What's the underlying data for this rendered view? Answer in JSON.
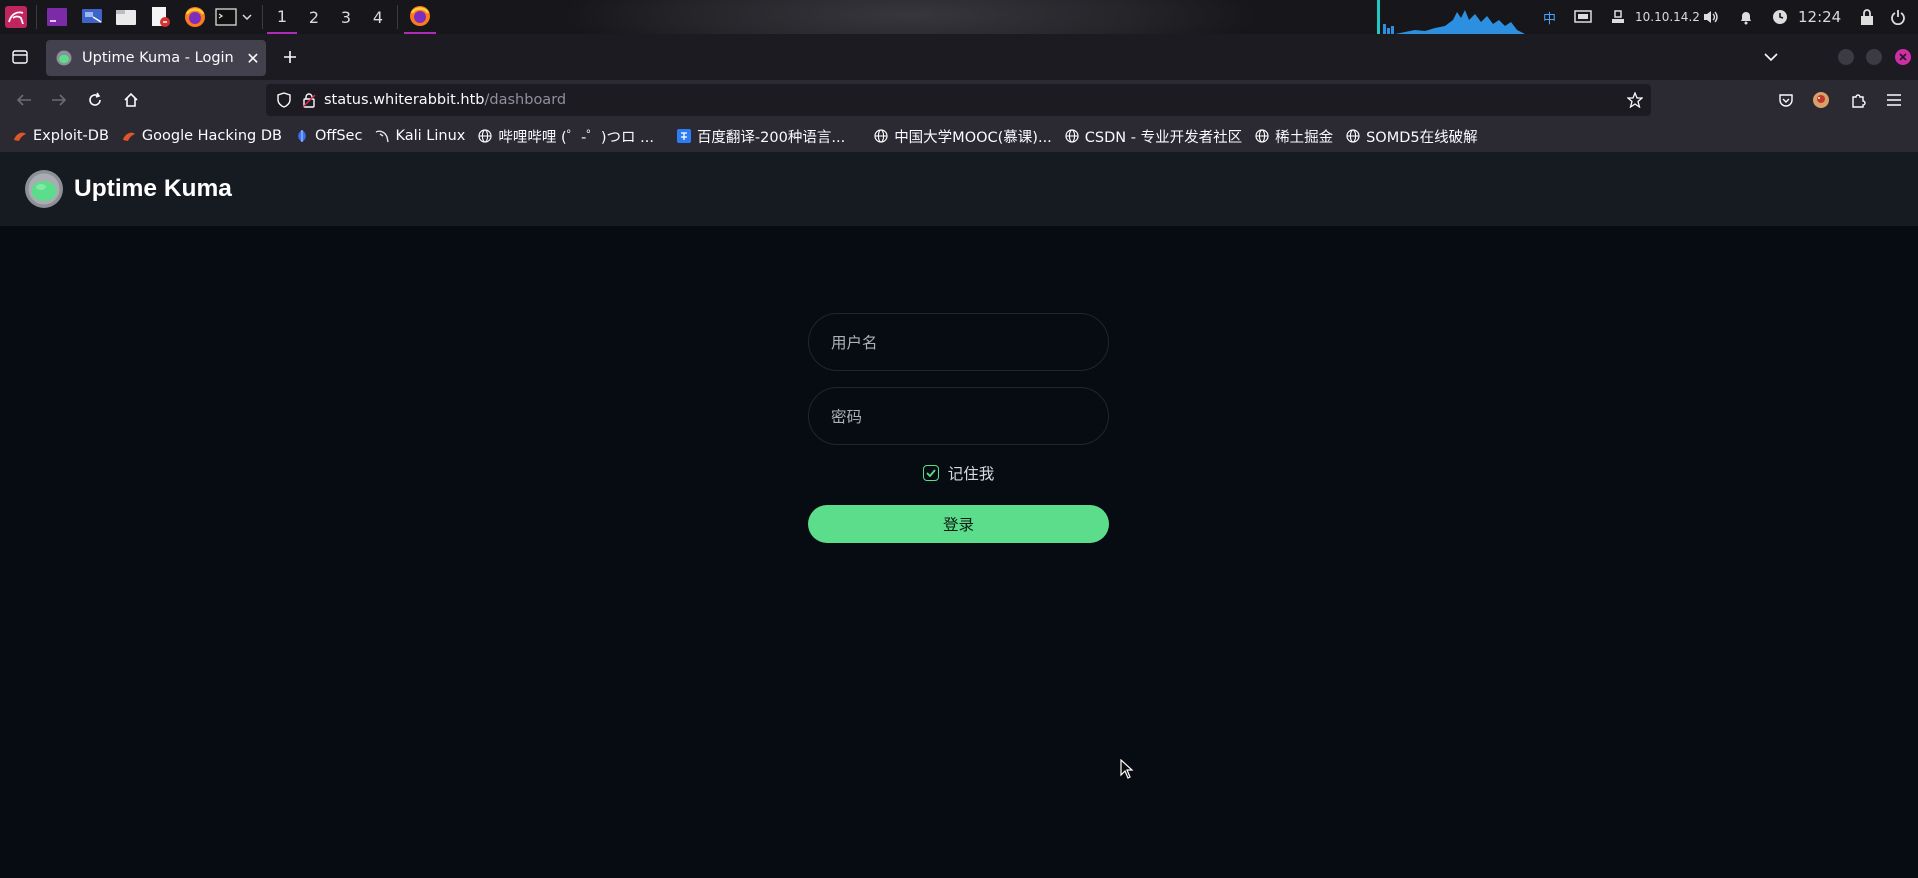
{
  "taskbar": {
    "workspaces": [
      "1",
      "2",
      "3",
      "4"
    ],
    "active_workspace": "1",
    "ime_label": "中",
    "ip_address": "10.10.14.2",
    "clock": "12:24"
  },
  "browser": {
    "tab": {
      "title": "Uptime Kuma - Login"
    },
    "url": {
      "host": "status.whiterabbit.htb",
      "path": "/dashboard"
    },
    "bookmarks": [
      {
        "label": "Exploit-DB",
        "icon": "exploit-db-icon"
      },
      {
        "label": "Google Hacking DB",
        "icon": "ghdb-icon"
      },
      {
        "label": "OffSec",
        "icon": "offsec-icon"
      },
      {
        "label": "Kali Linux",
        "icon": "kali-icon"
      },
      {
        "label": "哔哩哔哩 (゜-゜)つロ ...",
        "icon": "globe-icon"
      },
      {
        "label": "百度翻译-200种语言...",
        "icon": "baidu-translate-icon"
      },
      {
        "label": "中国大学MOOC(慕课)...",
        "icon": "globe-icon"
      },
      {
        "label": "CSDN - 专业开发者社区",
        "icon": "globe-icon"
      },
      {
        "label": "稀土掘金",
        "icon": "globe-icon"
      },
      {
        "label": "SOMD5在线破解",
        "icon": "globe-icon"
      }
    ]
  },
  "app": {
    "brand": "Uptime Kuma",
    "login": {
      "username_placeholder": "用户名",
      "password_placeholder": "密码",
      "remember_label": "记住我",
      "remember_checked": true,
      "submit_label": "登录"
    }
  },
  "colors": {
    "accent": "#5cdd8b",
    "page_bg": "#070c12",
    "header_bg": "#161b22"
  }
}
